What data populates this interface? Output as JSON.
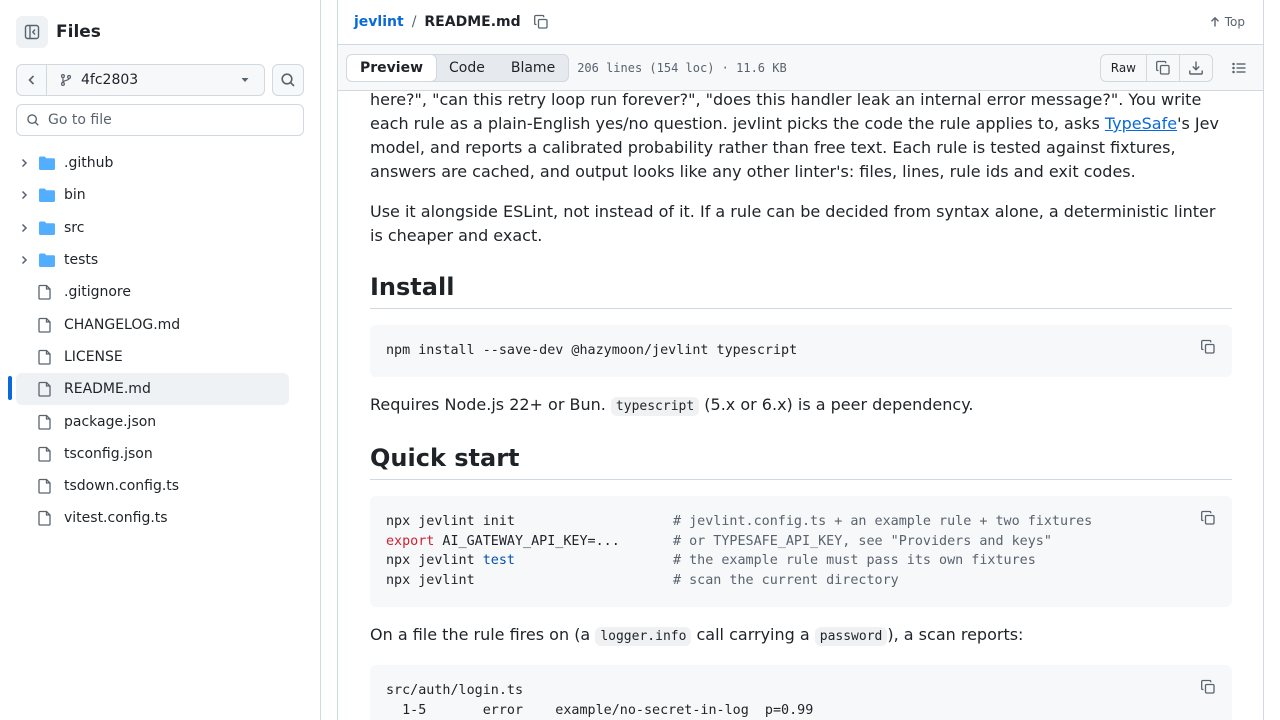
{
  "sidebar": {
    "title": "Files",
    "branch": "4fc2803",
    "goto_placeholder": "Go to file",
    "items": [
      {
        "name": ".github",
        "type": "folder"
      },
      {
        "name": "bin",
        "type": "folder"
      },
      {
        "name": "src",
        "type": "folder"
      },
      {
        "name": "tests",
        "type": "folder"
      },
      {
        "name": ".gitignore",
        "type": "file"
      },
      {
        "name": "CHANGELOG.md",
        "type": "file"
      },
      {
        "name": "LICENSE",
        "type": "file"
      },
      {
        "name": "README.md",
        "type": "file",
        "active": true
      },
      {
        "name": "package.json",
        "type": "file"
      },
      {
        "name": "tsconfig.json",
        "type": "file"
      },
      {
        "name": "tsdown.config.ts",
        "type": "file"
      },
      {
        "name": "vitest.config.ts",
        "type": "file"
      }
    ]
  },
  "header": {
    "repo": "jevlint",
    "sep": "/",
    "file": "README.md",
    "top_label": "Top"
  },
  "toolbar": {
    "tabs": [
      "Preview",
      "Code",
      "Blame"
    ],
    "active_tab": "Preview",
    "meta": "206 lines (154 loc) · 11.6 KB",
    "raw_label": "Raw"
  },
  "readme": {
    "intro_1": "here?\", \"can this retry loop run forever?\", \"does this handler leak an internal error message?\". You write each rule as a plain-English yes/no question. jevlint picks the code the rule applies to, asks ",
    "intro_link": "TypeSafe",
    "intro_2": "'s Jev model, and reports a calibrated probability rather than free text. Each rule is tested against fixtures, answers are cached, and output looks like any other linter's: files, lines, rule ids and exit codes.",
    "intro_p2": "Use it alongside ESLint, not instead of it. If a rule can be decided from syntax alone, a deterministic linter is cheaper and exact.",
    "install_heading": "Install",
    "install_cmd": "npm install --save-dev @hazymoon/jevlint typescript",
    "requires_1": "Requires Node.js 22+ or Bun. ",
    "requires_code": "typescript",
    "requires_2": " (5.x or 6.x) is a peer dependency.",
    "quick_heading": "Quick start",
    "quick_lines": [
      {
        "pre": "npx jevlint init",
        "kw": "",
        "fn": "",
        "post": "",
        "comment": "# jevlint.config.ts + an example rule + two fixtures"
      },
      {
        "pre": "",
        "kw": "export",
        "fn": "",
        "post": " AI_GATEWAY_API_KEY=...",
        "comment": "# or TYPESAFE_API_KEY, see \"Providers and keys\""
      },
      {
        "pre": "npx jevlint ",
        "kw": "",
        "fn": "test",
        "post": "",
        "comment": "# the example rule must pass its own fixtures"
      },
      {
        "pre": "npx jevlint",
        "kw": "",
        "fn": "",
        "post": "",
        "comment": "# scan the current directory"
      }
    ],
    "scan_1": "On a file the rule fires on (a ",
    "scan_code1": "logger.info",
    "scan_2": " call carrying a ",
    "scan_code2": "password",
    "scan_3": "), a scan reports:",
    "output_lines": [
      "src/auth/login.ts",
      "  1-5       error    example/no-secret-in-log  p=0.99"
    ]
  }
}
